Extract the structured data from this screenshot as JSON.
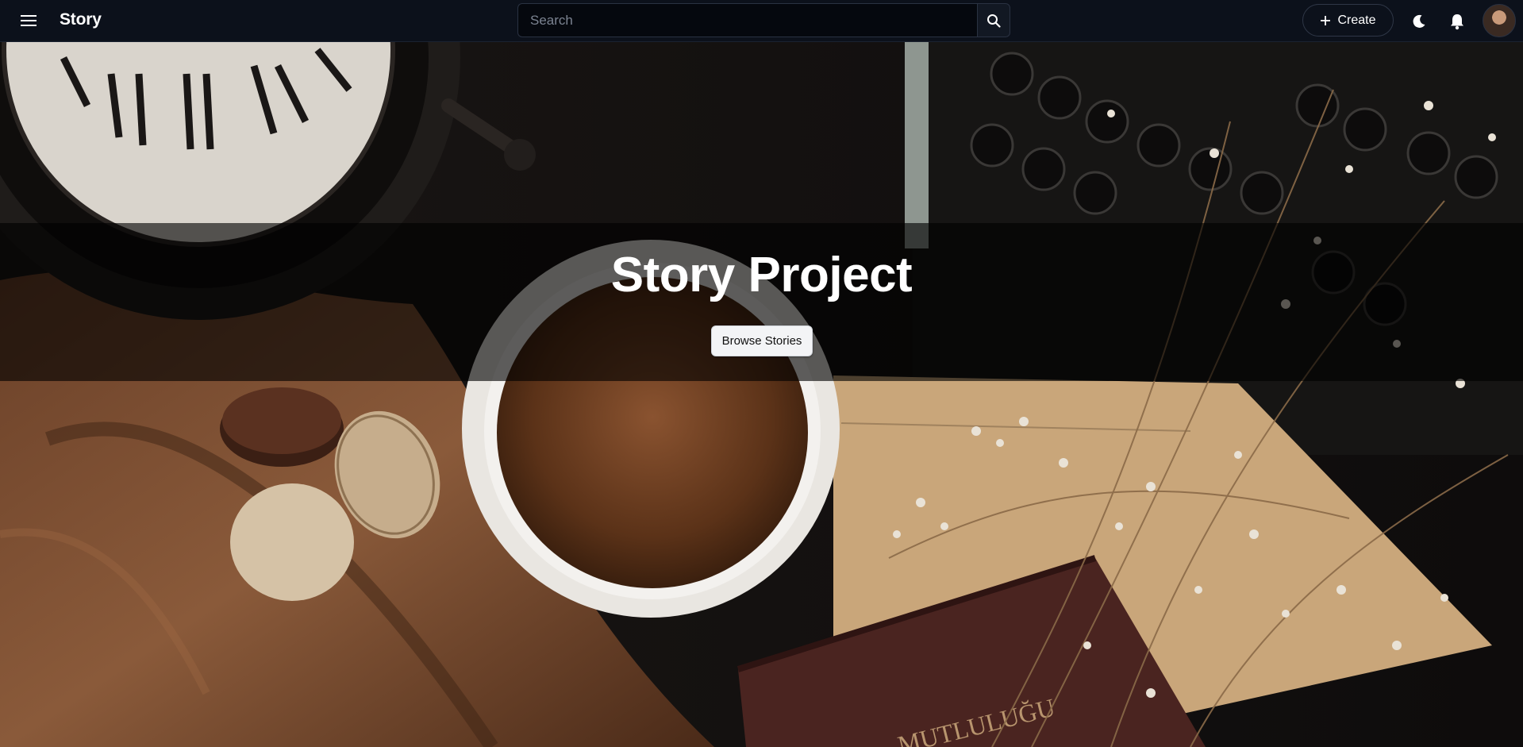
{
  "app": {
    "brand": "Story"
  },
  "search": {
    "placeholder": "Search"
  },
  "toolbar": {
    "create_label": "Create"
  },
  "icons": {
    "menu": "menu-icon",
    "search": "search-icon",
    "create": "plus-icon",
    "theme": "moon-icon",
    "notifications": "bell-icon"
  },
  "hero": {
    "title": "Story Project",
    "cta_label": "Browse Stories"
  },
  "colors": {
    "topbar": "#0c111b",
    "search_bg": "#05080e",
    "button_light": "#f3f4f6"
  }
}
